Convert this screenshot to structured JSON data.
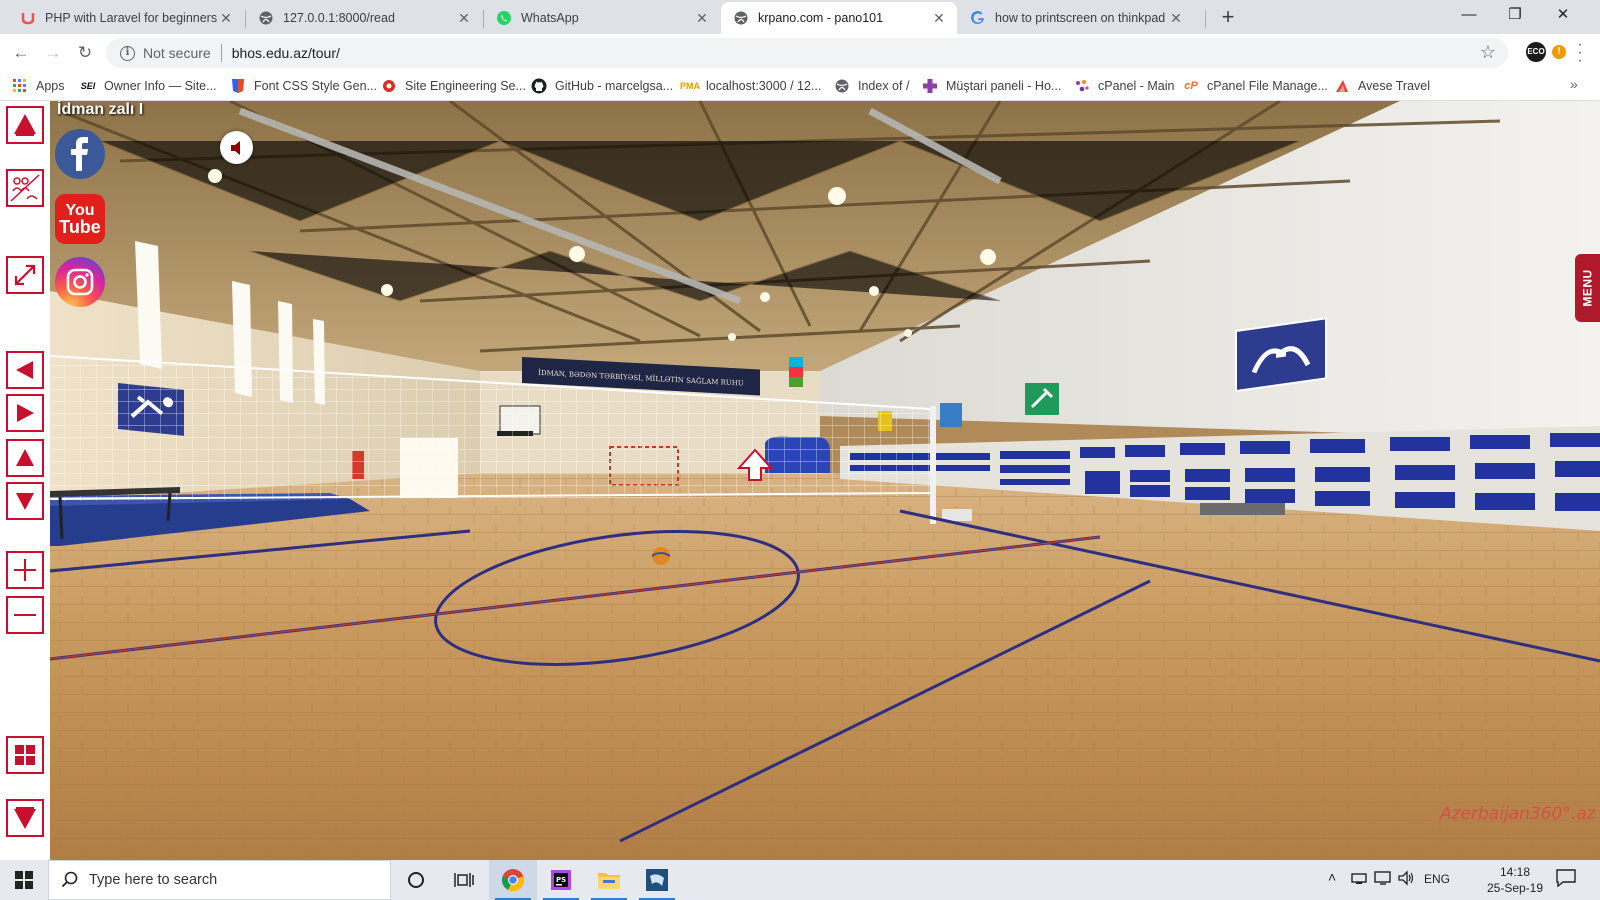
{
  "browser": {
    "tabs": [
      {
        "title": "PHP with Laravel for beginners -",
        "favicon": "udemy-icon",
        "active": false
      },
      {
        "title": "127.0.0.1:8000/read",
        "favicon": "globe-icon",
        "active": false
      },
      {
        "title": "WhatsApp",
        "favicon": "whatsapp-icon",
        "active": false
      },
      {
        "title": "krpano.com - pano101",
        "favicon": "globe-icon",
        "active": true
      },
      {
        "title": "how to printscreen on thinkpad",
        "favicon": "google-icon",
        "active": false
      }
    ],
    "new_tab": "+",
    "window_controls": {
      "minimize": "—",
      "restore": "❐",
      "close": "✕"
    },
    "security_label": "Not secure",
    "url": "bhos.edu.az/tour/",
    "extension_label": "ECO",
    "bookmarks": [
      {
        "label": "Apps",
        "icon": "apps-grid-icon"
      },
      {
        "label": "Owner Info — Site...",
        "icon": "sei-icon"
      },
      {
        "label": "Font CSS Style Gen...",
        "icon": "css-shield-icon"
      },
      {
        "label": "Site Engineering Se...",
        "icon": "seo-icon"
      },
      {
        "label": "GitHub - marcelgsa...",
        "icon": "github-icon"
      },
      {
        "label": "localhost:3000 / 12...",
        "icon": "phpmyadmin-icon"
      },
      {
        "label": "Index of /",
        "icon": "globe-icon"
      },
      {
        "label": "Müştari paneli - Ho...",
        "icon": "plus-cross-icon"
      },
      {
        "label": "cPanel - Main",
        "icon": "cpanel-dots-icon"
      },
      {
        "label": "cPanel File Manage...",
        "icon": "cpanel-icon"
      },
      {
        "label": "Avese Travel",
        "icon": "avese-icon"
      }
    ]
  },
  "tour": {
    "title": "İdman zalı I",
    "menu_label": "MENU",
    "banner_text": "İDMAN, BƏDƏN TƏRBİYƏSİ, MİLLƏTİN SAĞLAM RUHU",
    "watermark": "Azerbaijan360°.az",
    "social": [
      "facebook",
      "youtube",
      "instagram"
    ],
    "youtube_text": {
      "line1": "You",
      "line2": "Tube"
    }
  },
  "taskbar": {
    "search_placeholder": "Type here to search",
    "language": "ENG",
    "time": "14:18",
    "date": "25-Sep-19",
    "accent_color": "#2d7dd2"
  }
}
